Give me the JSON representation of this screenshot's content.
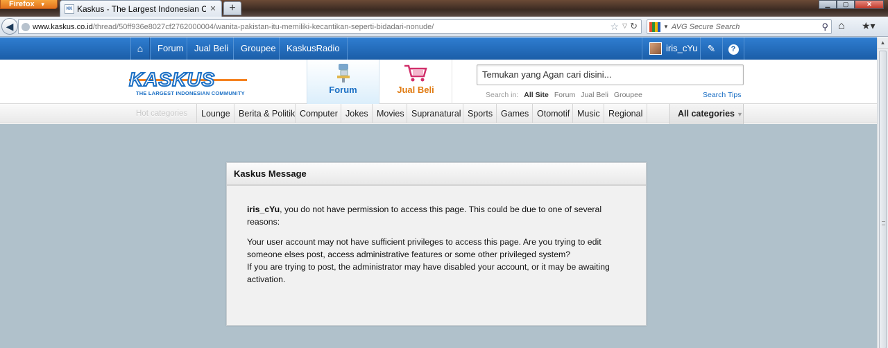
{
  "browser": {
    "menu_button": "Firefox",
    "tab_title": "Kaskus - The Largest Indonesian Comm...",
    "tab_favicon": "kaskus-favicon",
    "url_domain": "www.kaskus.co.id",
    "url_path": "/thread/50ff936e8027cf2762000004/wanita-pakistan-itu-memiliki-kecantikan-seperti-bidadari-nonude/",
    "search_placeholder": "AVG Secure Search"
  },
  "topbar": {
    "items": [
      "Forum",
      "Jual Beli",
      "Groupee",
      "KaskusRadio"
    ],
    "username": "iris_cYu",
    "help": "?"
  },
  "header": {
    "logo_word": "KASKUS",
    "logo_tagline": "THE LARGEST INDONESIAN COMMUNITY",
    "tab_forum": "Forum",
    "tab_jualbeli": "Jual Beli",
    "search_placeholder": "Temukan yang Agan cari disini...",
    "search_in_label": "Search in:",
    "search_in_options": [
      "All Site",
      "Forum",
      "Jual Beli",
      "Groupee"
    ],
    "search_tips": "Search Tips"
  },
  "categories": {
    "hot_label": "Hot categories",
    "items": [
      "Lounge",
      "Berita & Politik",
      "Computer",
      "Jokes",
      "Movies",
      "Supranatural",
      "Sports",
      "Games",
      "Otomotif",
      "Music",
      "Regional"
    ],
    "all_label": "All categories"
  },
  "message": {
    "title": "Kaskus Message",
    "user": "iris_cYu",
    "line1": ", you do not have permission to access this page. This could be due to one of several reasons:",
    "line2": "Your user account may not have sufficient privileges to access this page. Are you trying to edit someone elses post, access administrative features or some other privileged system?",
    "line3": "If you are trying to post, the administrator may have disabled your account, or it may be awaiting activation."
  },
  "colors": {
    "kaskus_blue": "#1b6fc4",
    "kaskus_orange": "#f58220",
    "page_bg": "#b0c1cb"
  }
}
